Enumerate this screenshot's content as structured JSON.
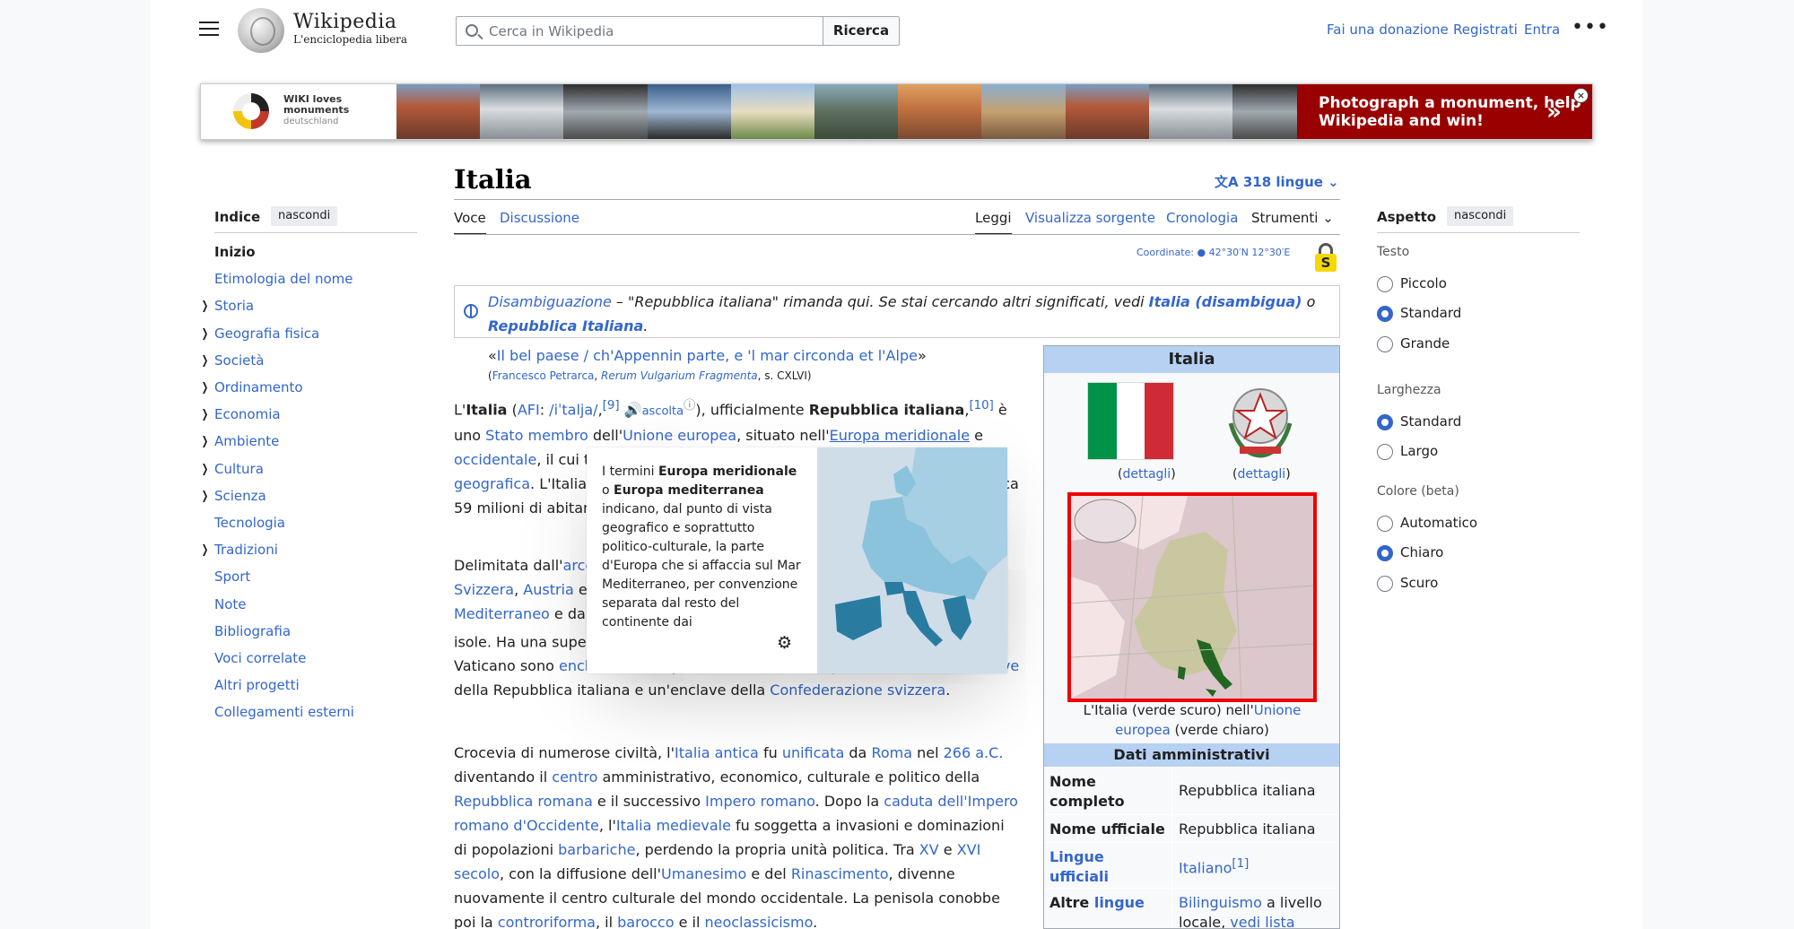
{
  "header": {
    "wordmark": "Wikipedia",
    "tagline": "L'enciclopedia libera",
    "search_placeholder": "Cerca in Wikipedia",
    "search_button": "Ricerca",
    "donate": "Fai una donazione",
    "register": "Registrati",
    "login": "Entra",
    "more": "•••"
  },
  "banner": {
    "logo_line1": "WIKI loves",
    "logo_line2": "monuments",
    "logo_line3": "deutschland",
    "cta": "Photograph a monument, help Wikipedia and win!",
    "arrow": "»",
    "close": "×"
  },
  "toc": {
    "title": "Indice",
    "hide": "nascondi",
    "items": [
      {
        "label": "Inizio",
        "bold": true,
        "expand": false
      },
      {
        "label": "Etimologia del nome",
        "expand": false
      },
      {
        "label": "Storia",
        "expand": true
      },
      {
        "label": "Geografia fisica",
        "expand": true
      },
      {
        "label": "Società",
        "expand": true
      },
      {
        "label": "Ordinamento",
        "expand": true
      },
      {
        "label": "Economia",
        "expand": true
      },
      {
        "label": "Ambiente",
        "expand": true
      },
      {
        "label": "Cultura",
        "expand": true
      },
      {
        "label": "Scienza",
        "expand": true
      },
      {
        "label": "Tecnologia",
        "expand": false
      },
      {
        "label": "Tradizioni",
        "expand": true
      },
      {
        "label": "Sport",
        "expand": false
      },
      {
        "label": "Note",
        "expand": false
      },
      {
        "label": "Bibliografia",
        "expand": false
      },
      {
        "label": "Voci correlate",
        "expand": false
      },
      {
        "label": "Altri progetti",
        "expand": false
      },
      {
        "label": "Collegamenti esterni",
        "expand": false
      }
    ]
  },
  "article": {
    "title": "Italia",
    "languages": "318 lingue",
    "tabs_left": [
      "Voce",
      "Discussione"
    ],
    "tabs_right": [
      "Leggi",
      "Visualizza sorgente",
      "Cronologia",
      "Strumenti"
    ],
    "coord_label": "Coordinate:",
    "coord_value": "42°30′N 12°30′E",
    "lock_letter": "S",
    "disambig_link": "Disambiguazione",
    "disambig_text": " – \"Repubblica italiana\" rimanda qui. Se stai cercando altri significati, vedi ",
    "disambig_link2": "Italia (disambigua)",
    "disambig_or": " o ",
    "disambig_link3": "Repubblica Italiana",
    "disambig_end": ".",
    "quote": "Il bel paese / ch'Appennin parte, e 'l mar circonda et l'Alpe",
    "quote_author": "Francesco Petrarca",
    "quote_work": "Rerum Vulgarium Fragmenta",
    "quote_ref": ", s. CXLVI)"
  },
  "popup": {
    "text_pre": "I termini ",
    "b1": "Europa meridionale",
    "mid": " o ",
    "b2": "Europa mediterranea",
    "text_post": " indicano, dal punto di vista geografico e soprattutto politico-culturale, la parte d'Europa che si affaccia sul Mar Mediterraneo, per convenzione separata dal resto del continente dai",
    "gear": "⚙"
  },
  "infobox": {
    "title": "Italia",
    "flag_link": "dettagli",
    "emblem_link": "dettagli",
    "caption_pre": "L'Italia (verde scuro) nell'",
    "caption_link": "Unione europea",
    "caption_post": " (verde chiaro)",
    "section": "Dati amministrativi",
    "rows": [
      {
        "k": "Nome completo",
        "v": "Repubblica italiana"
      },
      {
        "k": "Nome ufficiale",
        "v": "Repubblica italiana"
      },
      {
        "k": "Lingue ufficiali",
        "v": "Italiano",
        "sup": "[1]"
      },
      {
        "k_pre": "Altre ",
        "k_link": "lingue",
        "v_link": "Bilinguismo",
        "v_post": " a livello locale, ",
        "v_link2": "vedi lista"
      }
    ]
  },
  "aspect": {
    "title": "Aspetto",
    "hide": "nascondi",
    "text_label": "Testo",
    "text_options": [
      "Piccolo",
      "Standard",
      "Grande"
    ],
    "text_selected": 1,
    "width_label": "Larghezza",
    "width_options": [
      "Standard",
      "Largo"
    ],
    "width_selected": 0,
    "color_label": "Colore (beta)",
    "color_options": [
      "Automatico",
      "Chiaro",
      "Scuro"
    ],
    "color_selected": 1
  },
  "colors": {
    "link": "#3366cc",
    "infobox_header": "#b6d1f2",
    "banner_cta": "#990000",
    "map_border": "#ee0000"
  }
}
